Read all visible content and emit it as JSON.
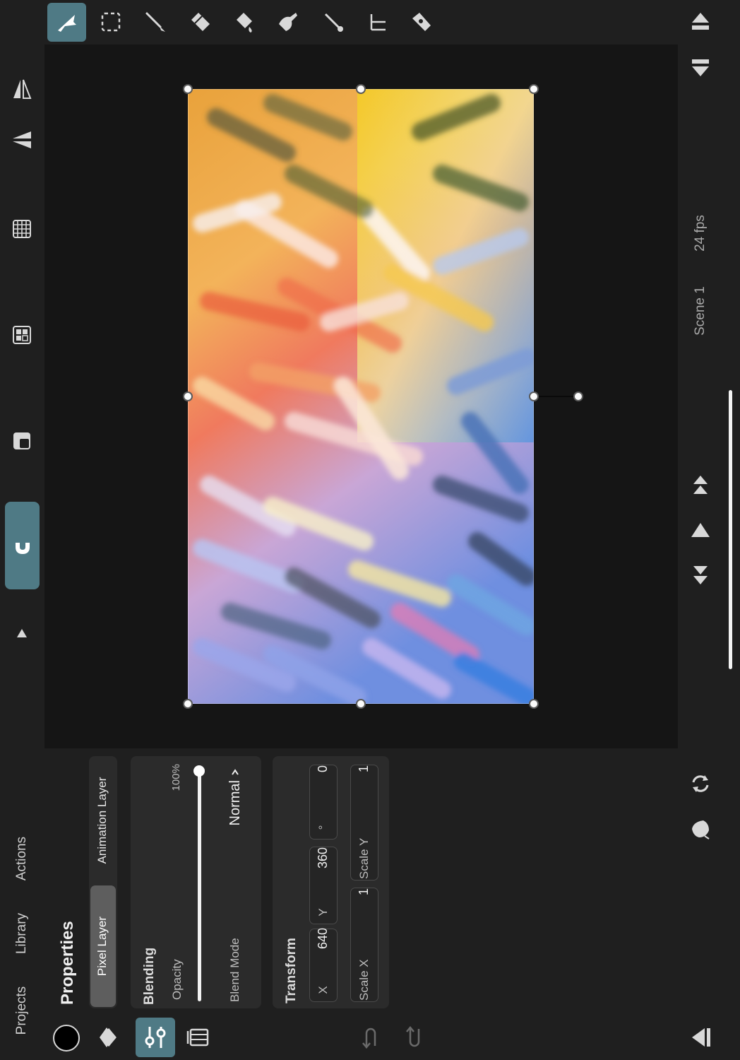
{
  "toolbar": {
    "tools": [
      {
        "name": "move-tool",
        "icon": "arrow-select-icon",
        "active": true
      },
      {
        "name": "selection-tool",
        "icon": "marquee-icon"
      },
      {
        "name": "brush-tool",
        "icon": "brush-icon"
      },
      {
        "name": "eraser-tool",
        "icon": "eraser-icon"
      },
      {
        "name": "fill-tool",
        "icon": "fill-icon"
      },
      {
        "name": "smudge-tool",
        "icon": "smudge-icon"
      },
      {
        "name": "color-picker-tool",
        "icon": "eyedropper-icon"
      },
      {
        "name": "measure-tool",
        "icon": "measure-icon"
      },
      {
        "name": "pen-tool",
        "icon": "pen-icon"
      }
    ]
  },
  "nav": {
    "projects": "Projects",
    "library": "Library",
    "actions": "Actions"
  },
  "timeline": {
    "scene": "Scene 1",
    "fps": "24 fps"
  },
  "properties": {
    "title": "Properties",
    "tabs": {
      "pixel_layer": "Pixel Layer",
      "animation_layer": "Animation Layer",
      "active": "Pixel Layer"
    },
    "blending": {
      "title": "Blending",
      "opacity_label": "Opacity",
      "opacity_value": "100%",
      "opacity_level": 1.0,
      "blend_mode_label": "Blend Mode",
      "blend_mode_value": "Normal"
    },
    "transform": {
      "title": "Transform",
      "x_label": "X",
      "x_value": "640",
      "y_label": "Y",
      "y_value": "360",
      "rotation_unit": "°",
      "rotation_value": "0",
      "scale_x_label": "Scale X",
      "scale_x_value": "1",
      "scale_y_label": "Scale Y",
      "scale_y_value": "1"
    }
  },
  "colors": {
    "accent": "#4f7a85",
    "panel_bg": "#2b2b2b",
    "canvas_bg": "#151515",
    "primary_color": "#000000"
  }
}
